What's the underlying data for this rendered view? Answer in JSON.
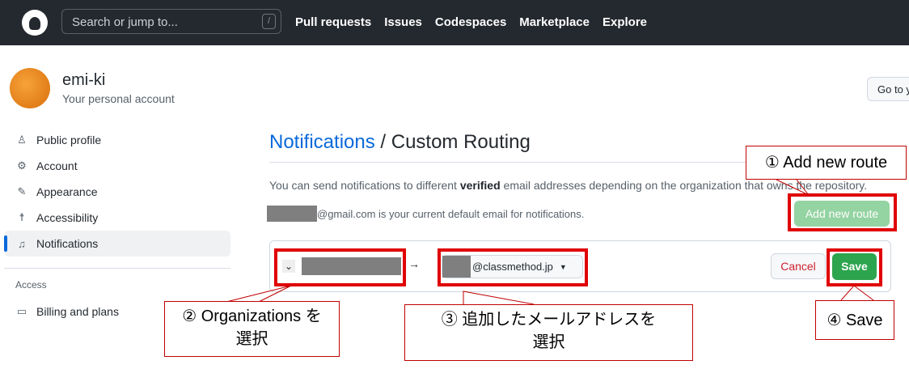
{
  "header": {
    "search_placeholder": "Search or jump to...",
    "slash_key": "/",
    "nav": [
      "Pull requests",
      "Issues",
      "Codespaces",
      "Marketplace",
      "Explore"
    ]
  },
  "user": {
    "name": "emi-ki",
    "subtitle": "Your personal account",
    "goto_label": "Go to y"
  },
  "sidebar": {
    "items": [
      {
        "label": "Public profile",
        "icon": "person-icon"
      },
      {
        "label": "Account",
        "icon": "gear-icon"
      },
      {
        "label": "Appearance",
        "icon": "paintbrush-icon"
      },
      {
        "label": "Accessibility",
        "icon": "accessibility-icon"
      },
      {
        "label": "Notifications",
        "icon": "bell-icon",
        "active": true
      }
    ],
    "section": "Access",
    "access_items": [
      {
        "label": "Billing and plans",
        "icon": "credit-card-icon"
      }
    ]
  },
  "main": {
    "title_link": "Notifications",
    "title_rest": " / Custom Routing",
    "desc_pre": "You can send notifications to different ",
    "desc_bold": "verified",
    "desc_post": " email addresses depending on the organization that owns the repository.",
    "default_email_suffix": "@gmail.com is your current default email for notifications.",
    "add_route_label": "Add new route",
    "arrow": "→",
    "email_suffix": "@classmethod.jp",
    "cancel_label": "Cancel",
    "save_label": "Save"
  },
  "callouts": {
    "c1": "① Add new route",
    "c2a": "② Organizations を",
    "c2b": "選択",
    "c3a": "③ 追加したメールアドレスを",
    "c3b": "選択",
    "c4": "④ Save"
  },
  "colors": {
    "header": "#24292f",
    "accent": "#0969da",
    "save": "#2da44e",
    "highlight": "#e00000"
  }
}
